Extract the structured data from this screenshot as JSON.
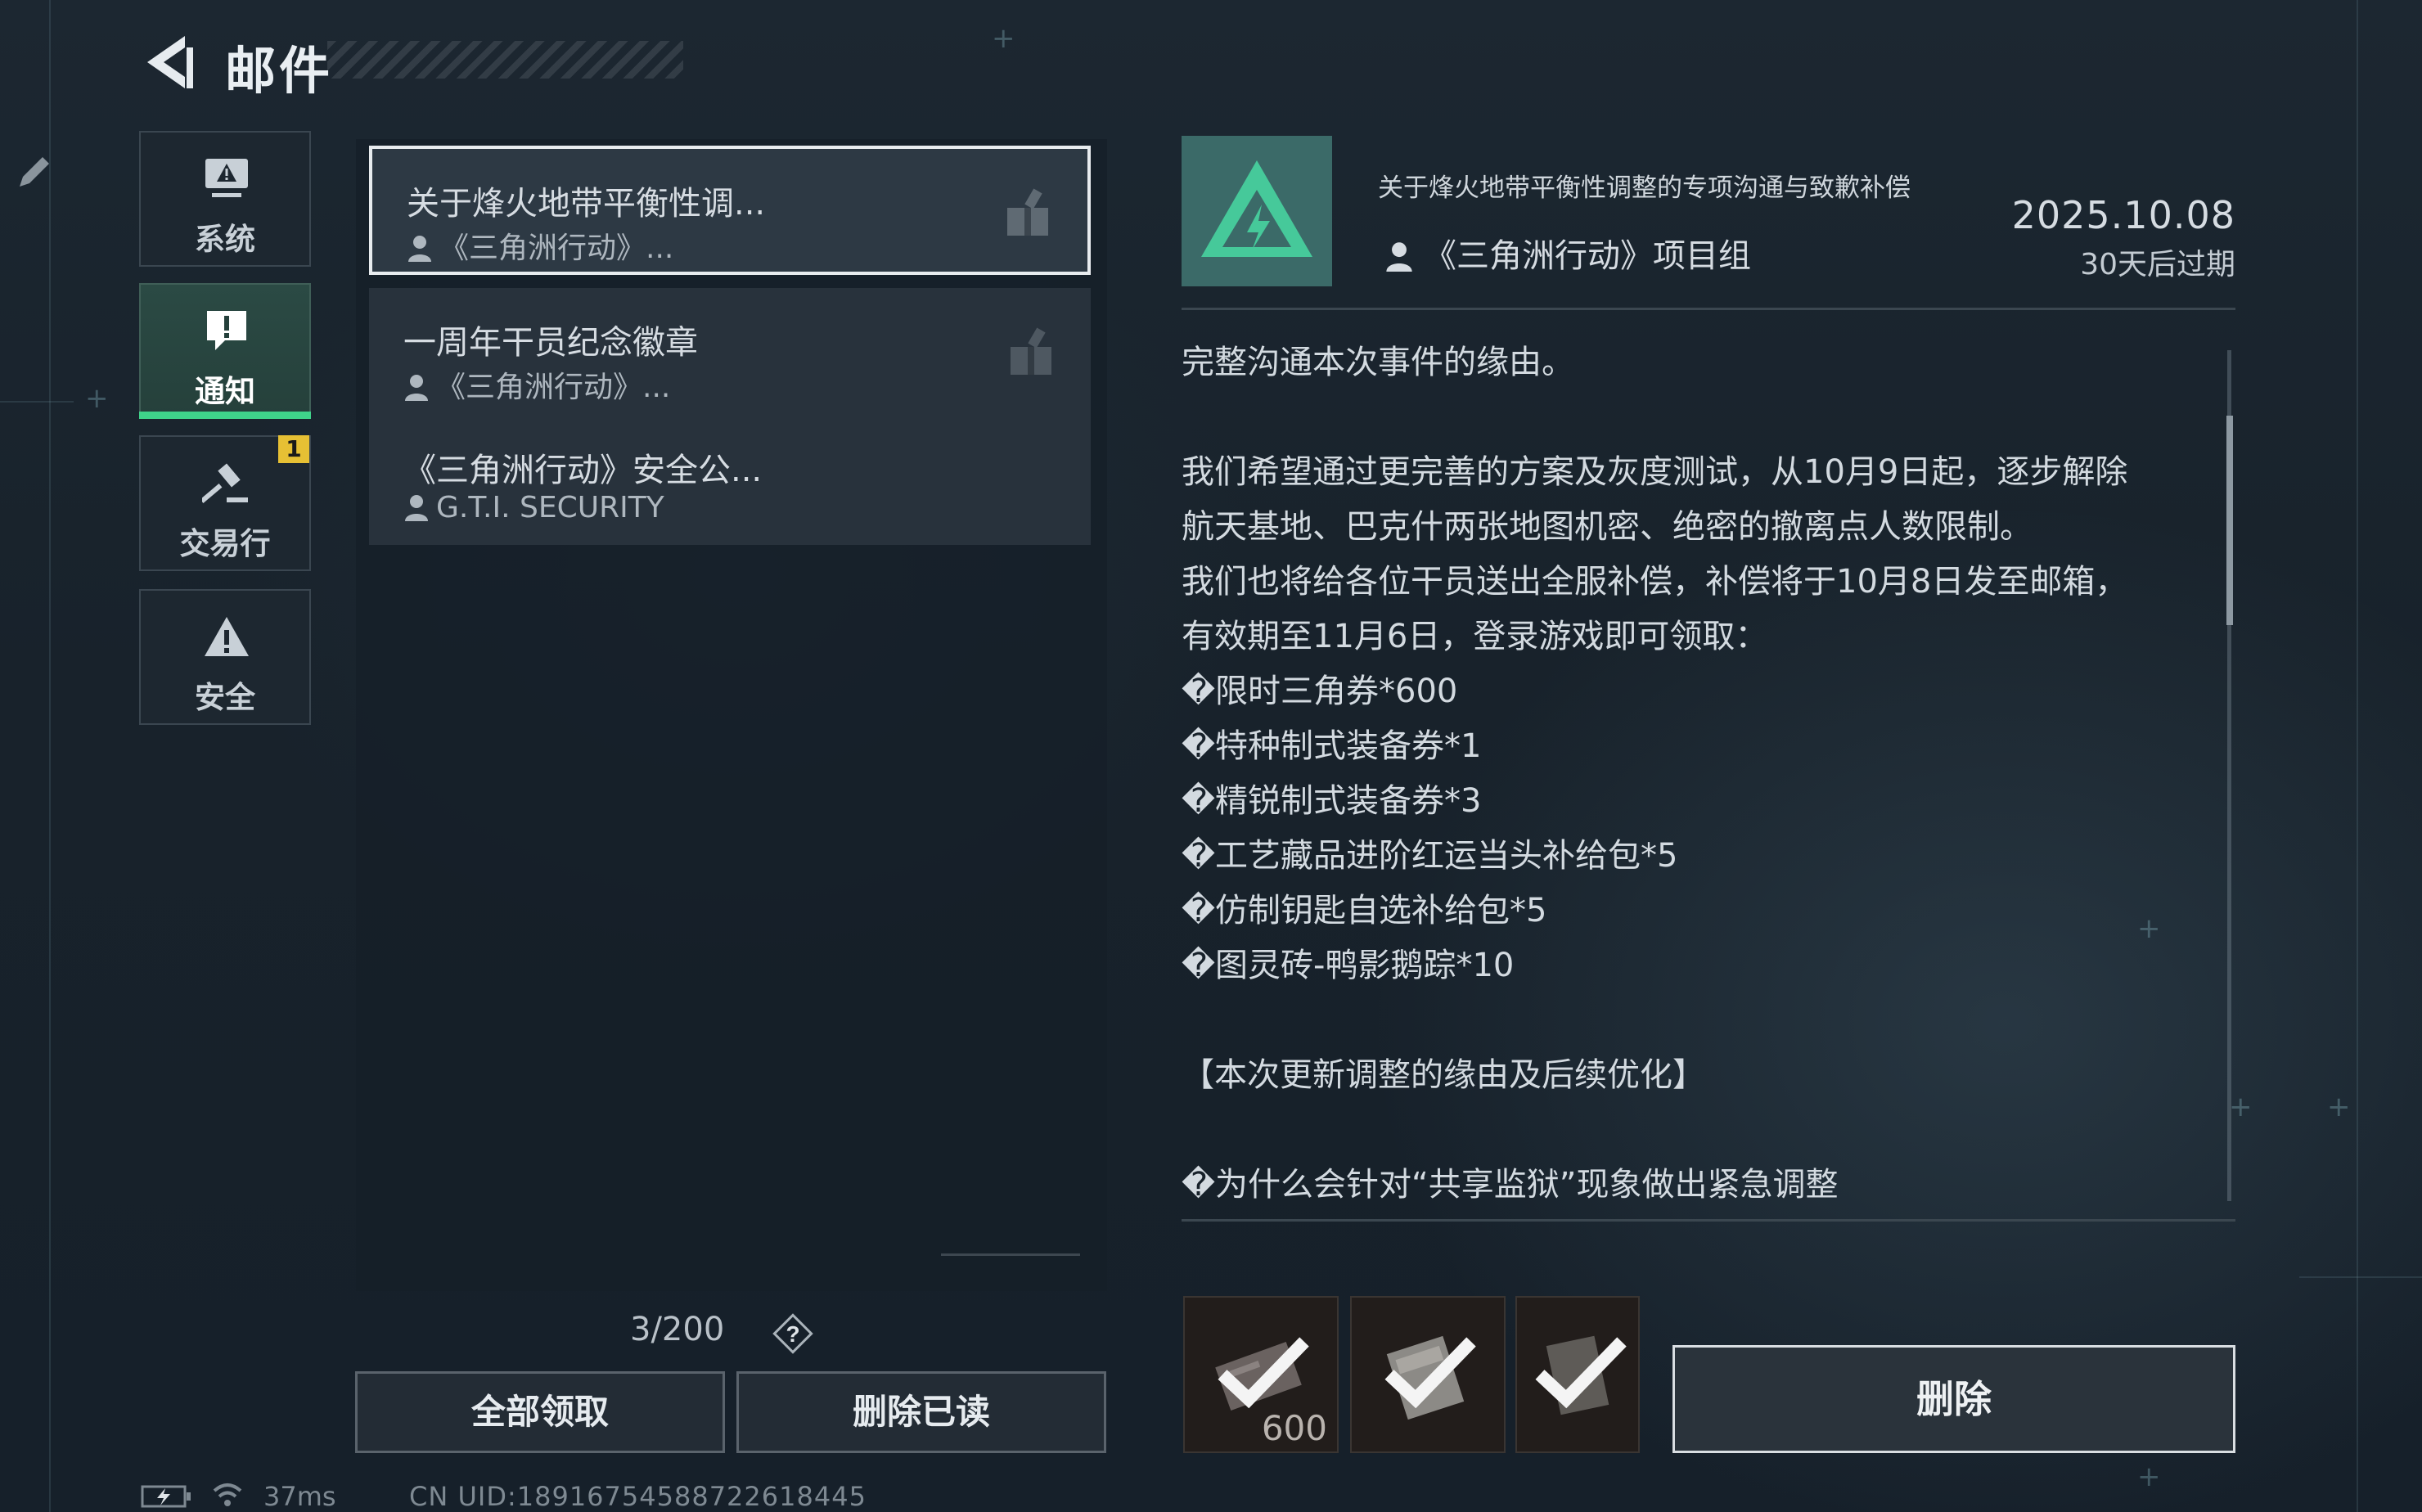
{
  "header": {
    "title": "邮件"
  },
  "categories": [
    {
      "label": "系统",
      "icon": "monitor-alert-icon",
      "active": false
    },
    {
      "label": "通知",
      "icon": "exclamation-icon",
      "active": true
    },
    {
      "label": "交易行",
      "icon": "gavel-icon",
      "active": false,
      "badge": "1"
    },
    {
      "label": "安全",
      "icon": "warning-triangle-icon",
      "active": false
    }
  ],
  "mails": [
    {
      "title": "关于烽火地带平衡性调...",
      "sender": "《三角洲行动》...",
      "has_attachment": true,
      "selected": true
    },
    {
      "title": "一周年干员纪念徽章",
      "sender": "《三角洲行动》...",
      "has_attachment": true,
      "selected": false
    },
    {
      "title": "《三角洲行动》安全公...",
      "sender": "G.T.I. SECURITY",
      "has_attachment": false,
      "selected": false
    }
  ],
  "mail_count": "3/200",
  "help_icon": "?",
  "buttons": {
    "claim_all": "全部领取",
    "delete_read": "删除已读",
    "delete": "删除"
  },
  "status": {
    "ping": "37ms",
    "uid": "CN UID:18916754588722618445"
  },
  "detail": {
    "subject": "关于烽火地带平衡性调整的专项沟通与致歉补偿",
    "sender": "《三角洲行动》项目组",
    "date": "2025.10.08",
    "expiry": "30天后过期",
    "body": [
      "完整沟通本次事件的缘由。",
      "",
      "我们希望通过更完善的方案及灰度测试，从10月9日起，逐步解除",
      "航天基地、巴克什两张地图机密、绝密的撤离点人数限制。",
      "我们也将给各位干员送出全服补偿，补偿将于10月8日发至邮箱，",
      "有效期至11月6日，登录游戏即可领取：",
      "�限时三角券*600",
      "�特种制式装备券*1",
      "�精锐制式装备券*3",
      "�工艺藏品进阶红运当头补给包*5",
      "�仿制钥匙自选补给包*5",
      "�图灵砖-鸭影鹅踪*10",
      "",
      "【本次更新调整的缘由及后续优化】",
      "",
      "�为什么会针对“共享监狱”现象做出紧急调整"
    ]
  },
  "rewards": [
    {
      "name": "限时三角券",
      "quantity": "600",
      "claimed": true
    },
    {
      "name": "reward-item-2",
      "quantity": "",
      "claimed": true
    },
    {
      "name": "reward-item-3",
      "quantity": "",
      "claimed": true
    }
  ],
  "colors": {
    "accent": "#3fd38a",
    "badge": "#e6c034",
    "logo_bg": "#3b6a68"
  }
}
